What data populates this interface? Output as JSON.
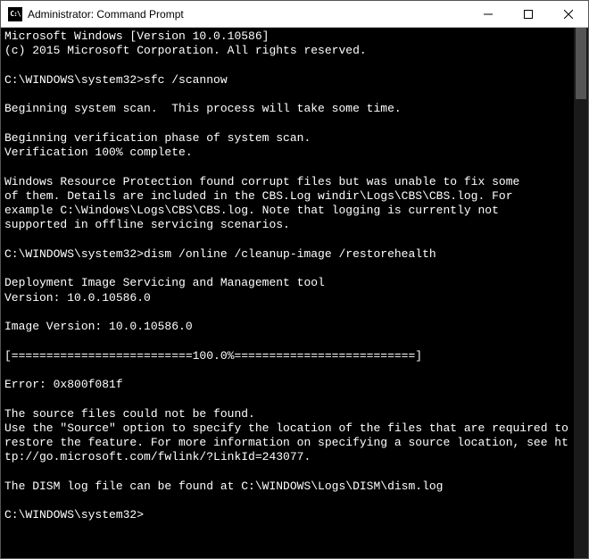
{
  "titlebar": {
    "icon_label": "CMD",
    "title": "Administrator: Command Prompt"
  },
  "terminal": {
    "lines": [
      "Microsoft Windows [Version 10.0.10586]",
      "(c) 2015 Microsoft Corporation. All rights reserved.",
      "",
      "C:\\WINDOWS\\system32>sfc /scannow",
      "",
      "Beginning system scan.  This process will take some time.",
      "",
      "Beginning verification phase of system scan.",
      "Verification 100% complete.",
      "",
      "Windows Resource Protection found corrupt files but was unable to fix some",
      "of them. Details are included in the CBS.Log windir\\Logs\\CBS\\CBS.log. For",
      "example C:\\Windows\\Logs\\CBS\\CBS.log. Note that logging is currently not",
      "supported in offline servicing scenarios.",
      "",
      "C:\\WINDOWS\\system32>dism /online /cleanup-image /restorehealth",
      "",
      "Deployment Image Servicing and Management tool",
      "Version: 10.0.10586.0",
      "",
      "Image Version: 10.0.10586.0",
      "",
      "[==========================100.0%==========================]",
      "",
      "Error: 0x800f081f",
      "",
      "The source files could not be found.",
      "Use the \"Source\" option to specify the location of the files that are required to restore the feature. For more information on specifying a source location, see http://go.microsoft.com/fwlink/?LinkId=243077.",
      "",
      "The DISM log file can be found at C:\\WINDOWS\\Logs\\DISM\\dism.log",
      "",
      "C:\\WINDOWS\\system32>"
    ]
  }
}
